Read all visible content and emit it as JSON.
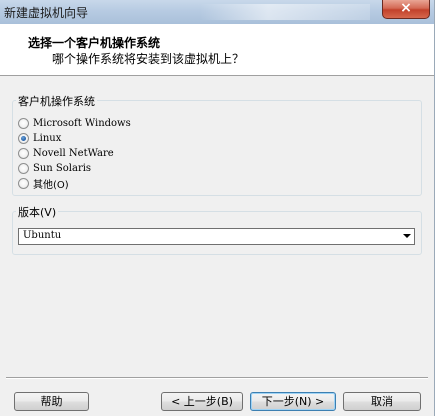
{
  "window": {
    "title": "新建虚拟机向导",
    "close_glyph": "×"
  },
  "header": {
    "title": "选择一个客户机操作系统",
    "subtitle": "哪个操作系统将安装到该虚拟机上？"
  },
  "guest_os": {
    "legend": "客户机操作系统",
    "options": [
      {
        "label": "Microsoft Windows",
        "selected": false
      },
      {
        "label": "Linux",
        "selected": true
      },
      {
        "label": "Novell NetWare",
        "selected": false
      },
      {
        "label": "Sun Solaris",
        "selected": false
      },
      {
        "label": "其他(O)",
        "selected": false
      }
    ]
  },
  "version": {
    "legend": "版本(V)",
    "selected": "Ubuntu"
  },
  "buttons": {
    "help": "帮助",
    "back": "< 上一步(B)",
    "next": "下一步(N) >",
    "cancel": "取消"
  }
}
